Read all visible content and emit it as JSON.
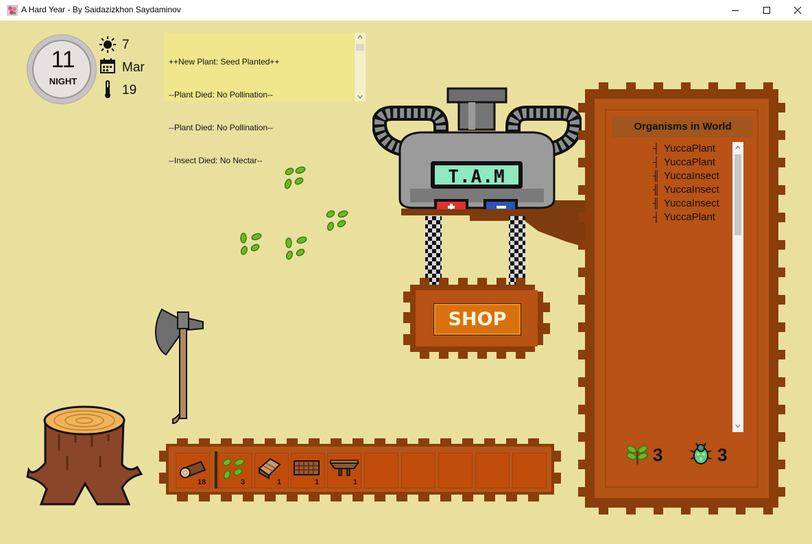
{
  "window": {
    "title": "A Hard Year - By Saidazizkhon Saydaminov",
    "icons": {
      "app": "flower-icon",
      "minimize": "minimize-icon",
      "maximize": "maximize-icon",
      "close": "close-icon"
    }
  },
  "status": {
    "day": "11",
    "period": "NIGHT",
    "weather_value": "7",
    "month": "Mar",
    "temperature": "19",
    "icons": {
      "weather": "sun-icon",
      "month": "calendar-icon",
      "temperature": "thermometer-icon"
    }
  },
  "log": {
    "lines": [
      "++New Plant: Seed Planted++",
      "--Plant Died: No Pollination--",
      "--Plant Died: No Pollination--",
      "--Insect Died: No Nectar--"
    ]
  },
  "machine": {
    "screen_label": "T.A.M"
  },
  "shop": {
    "label": "SHOP"
  },
  "organisms": {
    "title": "Organisms in World",
    "items": [
      {
        "mark": "┤",
        "label": "YuccaPlant"
      },
      {
        "mark": "┤",
        "label": "YuccaPlant"
      },
      {
        "mark": "╢",
        "label": "YuccaInsect"
      },
      {
        "mark": "╢",
        "label": "YuccaInsect"
      },
      {
        "mark": "╢",
        "label": "YuccaInsect"
      },
      {
        "mark": "┤",
        "label": "YuccaPlant"
      }
    ],
    "plant_count": "3",
    "insect_count": "3",
    "icons": {
      "plant": "plant-sprout-icon",
      "insect": "beetle-icon"
    }
  },
  "inventory": {
    "slots": [
      {
        "item": "log-icon",
        "count": "18"
      },
      {
        "item": "seeds-icon",
        "count": "3"
      },
      {
        "item": "wooden-crate-icon",
        "count": "1"
      },
      {
        "item": "fence-icon",
        "count": "1"
      },
      {
        "item": "workbench-icon",
        "count": "1"
      },
      {
        "item": "",
        "count": ""
      },
      {
        "item": "",
        "count": ""
      },
      {
        "item": "",
        "count": ""
      },
      {
        "item": "",
        "count": ""
      },
      {
        "item": "",
        "count": ""
      }
    ]
  },
  "colors": {
    "background": "#eae09e",
    "panel_brown": "#b45517",
    "panel_dark": "#7a3a0c",
    "shop_orange": "#d9720e",
    "log_yellow": "#f0e68c"
  }
}
